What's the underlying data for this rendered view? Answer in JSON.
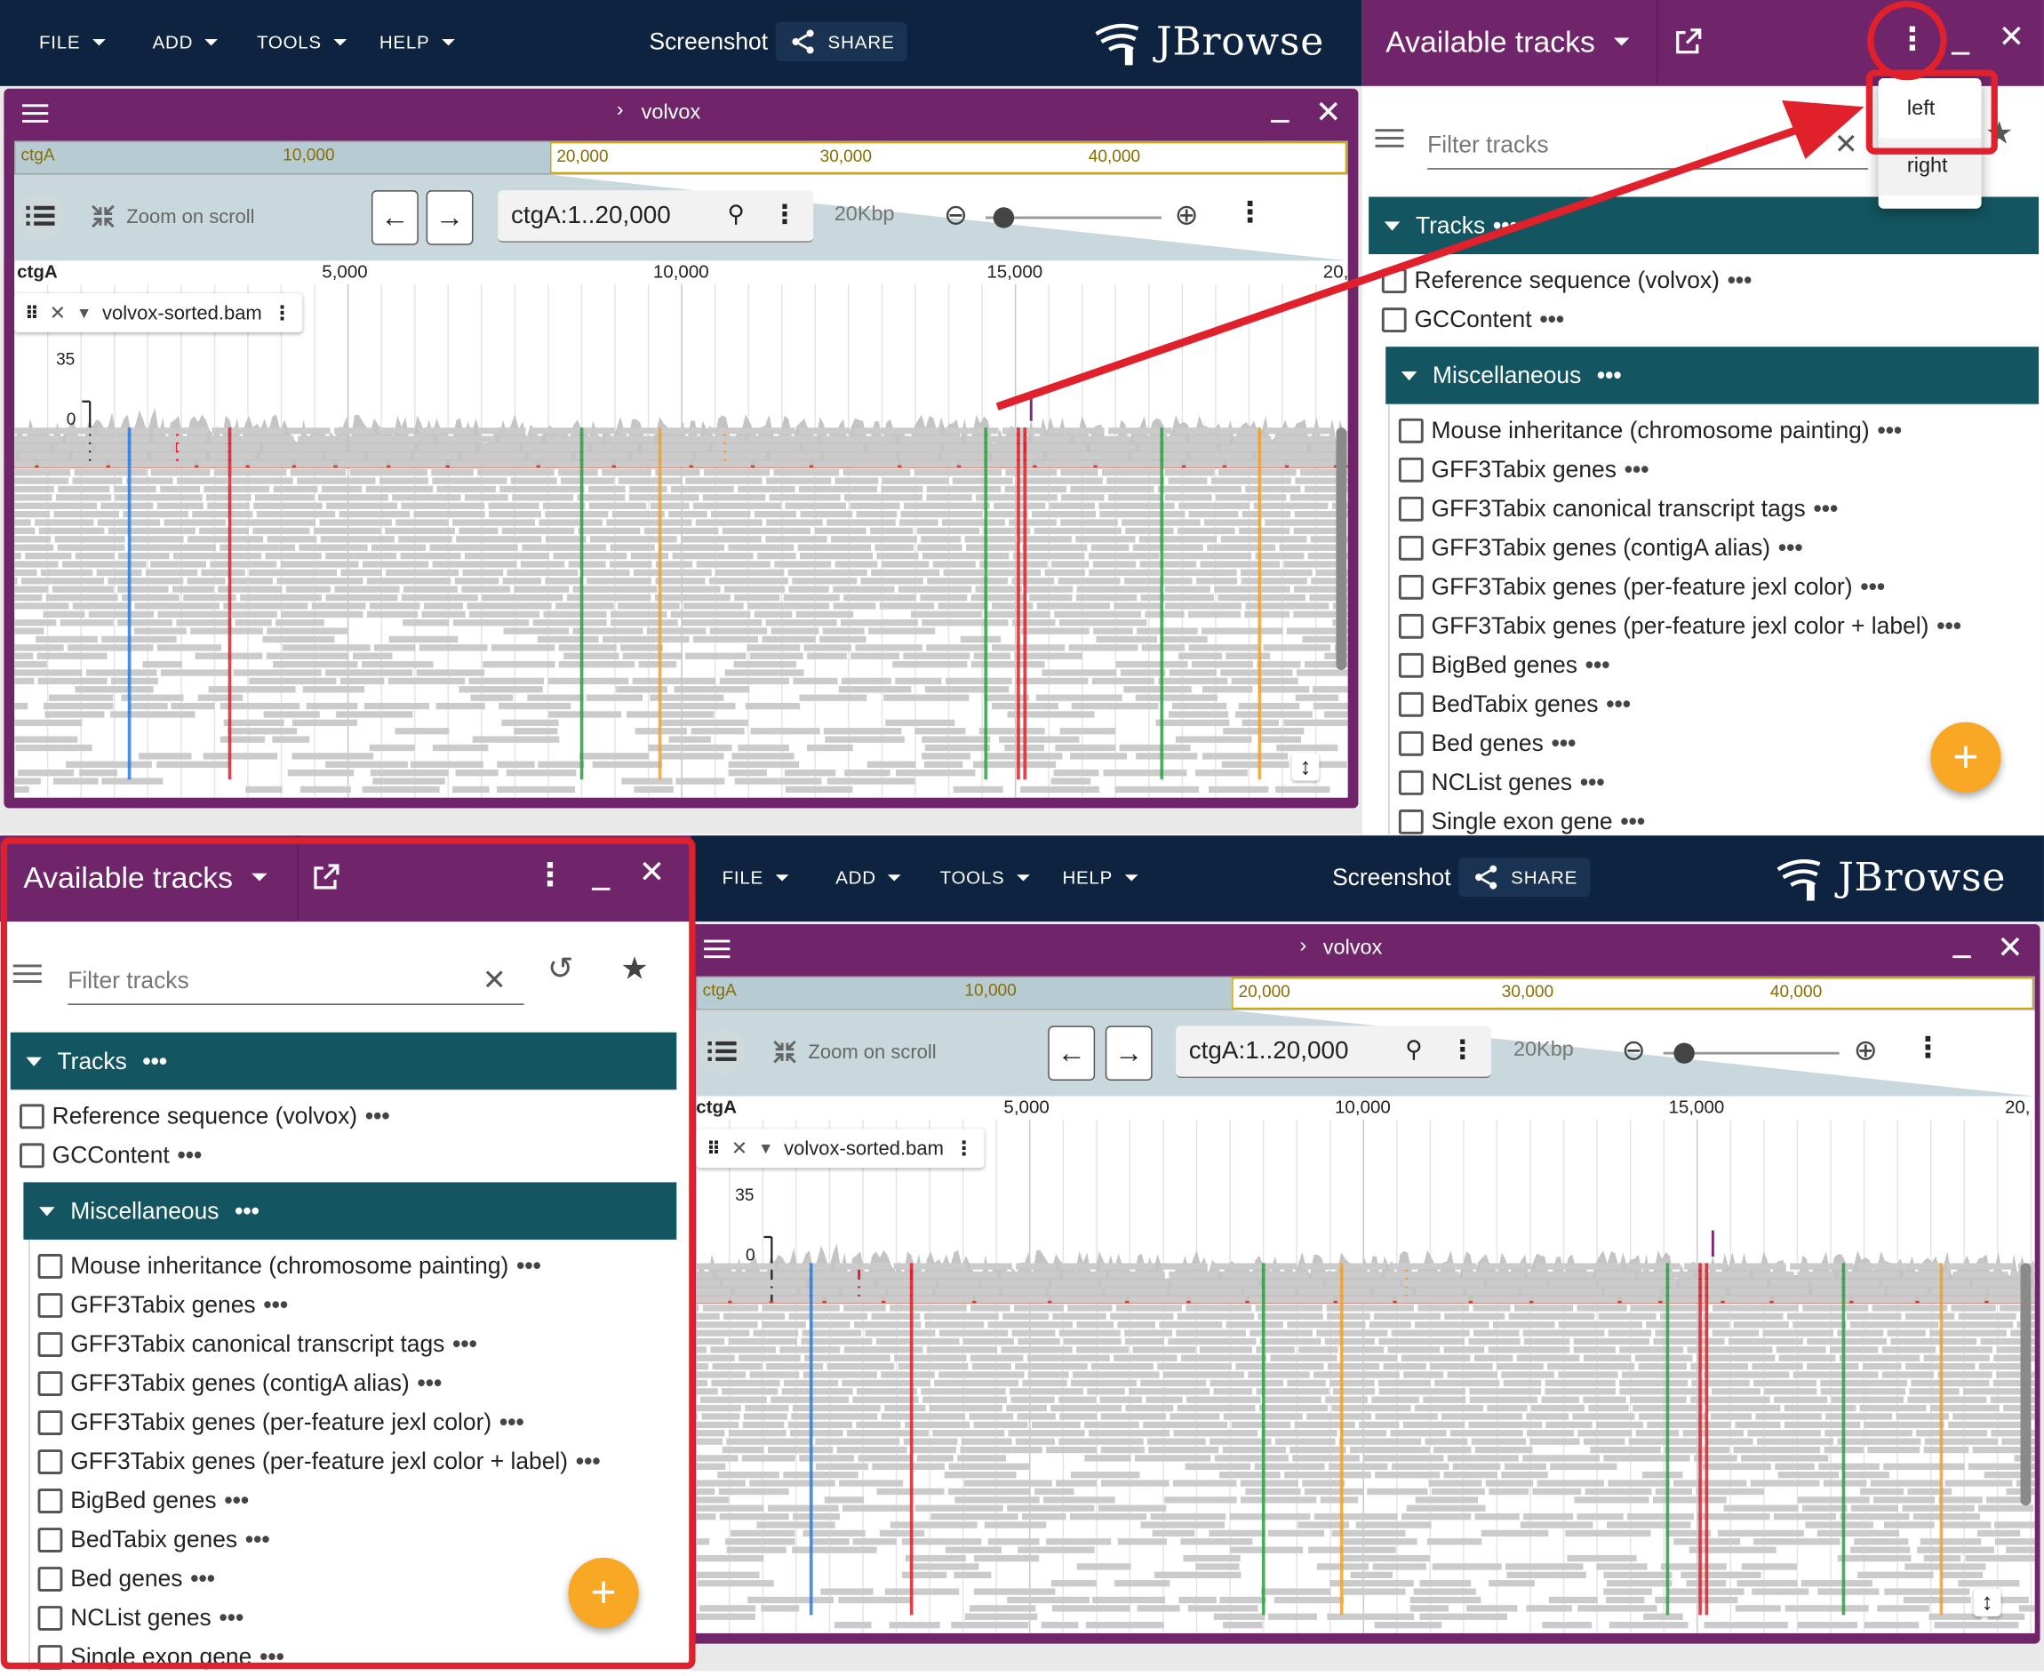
{
  "menus": [
    {
      "label": "FILE"
    },
    {
      "label": "ADD"
    },
    {
      "label": "TOOLS"
    },
    {
      "label": "HELP"
    }
  ],
  "screenshot_label": "Screenshot",
  "share_label": "SHARE",
  "logo_text": "JBrowse",
  "view": {
    "title": "volvox",
    "overview_labels": [
      "ctgA",
      "10,000",
      "20,000",
      "30,000",
      "40,000"
    ],
    "zoom_on_scroll": "Zoom on scroll",
    "location": "ctgA:1..20,000",
    "span": "20Kbp",
    "ruler_ref": "ctgA",
    "ruler_ticks": [
      "5,000",
      "10,000",
      "15,000",
      "20,"
    ],
    "track_name": "volvox-sorted.bam",
    "coverage_max": "35",
    "coverage_min": "0"
  },
  "drawer": {
    "title": "Available tracks",
    "filter_placeholder": "Filter tracks",
    "category_tracks": "Tracks",
    "category_misc": "Miscellaneous",
    "dots": "•••",
    "top_items": [
      "Reference sequence (volvox)",
      "GCContent"
    ],
    "misc_items": [
      "Mouse inheritance (chromosome painting)",
      "GFF3Tabix genes",
      "GFF3Tabix canonical transcript tags",
      "GFF3Tabix genes (contigA alias)",
      "GFF3Tabix genes (per-feature jexl color)",
      "GFF3Tabix genes (per-feature jexl color + label)",
      "BigBed genes",
      "BedTabix genes",
      "Bed genes",
      "NCList genes",
      "Single exon gene"
    ]
  },
  "dropdown": {
    "left": "left",
    "right": "right"
  },
  "colors": {
    "appbar": "#0d233f",
    "view_header": "#70256b",
    "category": "#135560",
    "fab": "#f9a825",
    "annotation": "#e0202a"
  }
}
